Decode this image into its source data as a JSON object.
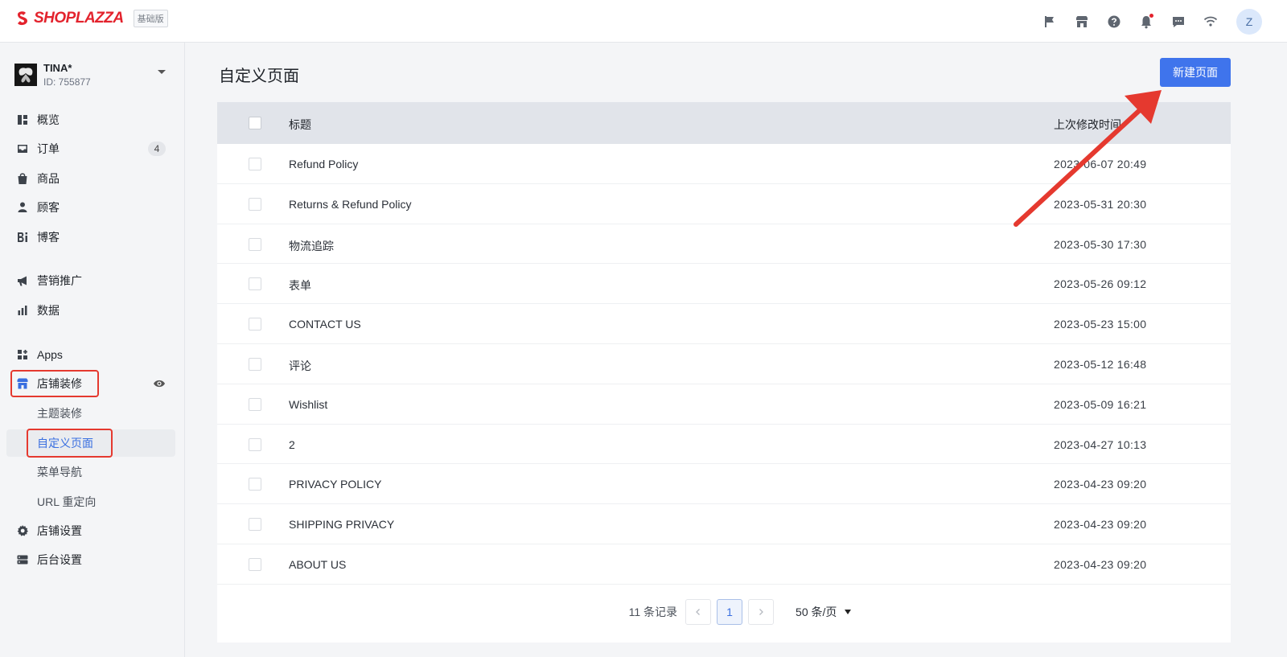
{
  "brand": {
    "logo_text": "SHOPLAZZA",
    "plan": "基础版"
  },
  "topbar": {
    "icons": [
      "flag-icon",
      "store-icon",
      "help-icon",
      "bell-icon",
      "message-icon",
      "wifi-icon"
    ],
    "avatar_letter": "Z"
  },
  "store": {
    "name": "TINA*",
    "id": "ID: 755877"
  },
  "sidebar": {
    "items": [
      {
        "label": "概览",
        "icon": "dashboard-icon"
      },
      {
        "label": "订单",
        "icon": "inbox-icon",
        "badge": "4"
      },
      {
        "label": "商品",
        "icon": "bag-icon"
      },
      {
        "label": "顾客",
        "icon": "person-icon"
      },
      {
        "label": "博客",
        "icon": "blog-icon"
      },
      {
        "label": "营销推广",
        "icon": "megaphone-icon"
      },
      {
        "label": "数据",
        "icon": "bar-chart-icon"
      },
      {
        "label": "Apps",
        "icon": "apps-icon"
      },
      {
        "label": "店铺装修",
        "icon": "storefront-icon"
      },
      {
        "label": "店铺设置",
        "icon": "gear-icon"
      },
      {
        "label": "后台设置",
        "icon": "server-icon"
      }
    ],
    "sub_items": [
      {
        "label": "主题装修"
      },
      {
        "label": "自定义页面"
      },
      {
        "label": "菜单导航"
      },
      {
        "label": "URL 重定向"
      }
    ]
  },
  "main": {
    "title": "自定义页面",
    "new_button": "新建页面",
    "table": {
      "headers": {
        "title": "标题",
        "modified": "上次修改时间"
      },
      "rows": [
        {
          "title": "Refund Policy",
          "time": "2023-06-07 20:49"
        },
        {
          "title": "Returns & Refund Policy",
          "time": "2023-05-31 20:30"
        },
        {
          "title": "物流追踪",
          "time": "2023-05-30 17:30"
        },
        {
          "title": "表单",
          "time": "2023-05-26 09:12"
        },
        {
          "title": "CONTACT US",
          "time": "2023-05-23 15:00"
        },
        {
          "title": "评论",
          "time": "2023-05-12 16:48"
        },
        {
          "title": "Wishlist",
          "time": "2023-05-09 16:21"
        },
        {
          "title": "2",
          "time": "2023-04-27 10:13"
        },
        {
          "title": "PRIVACY POLICY",
          "time": "2023-04-23 09:20"
        },
        {
          "title": "SHIPPING PRIVACY",
          "time": "2023-04-23 09:20"
        },
        {
          "title": "ABOUT US",
          "time": "2023-04-23 09:20"
        }
      ]
    },
    "pagination": {
      "total": "11 条记录",
      "current": "1",
      "page_size": "50 条/页"
    }
  },
  "annotation_color": "#e5392f"
}
